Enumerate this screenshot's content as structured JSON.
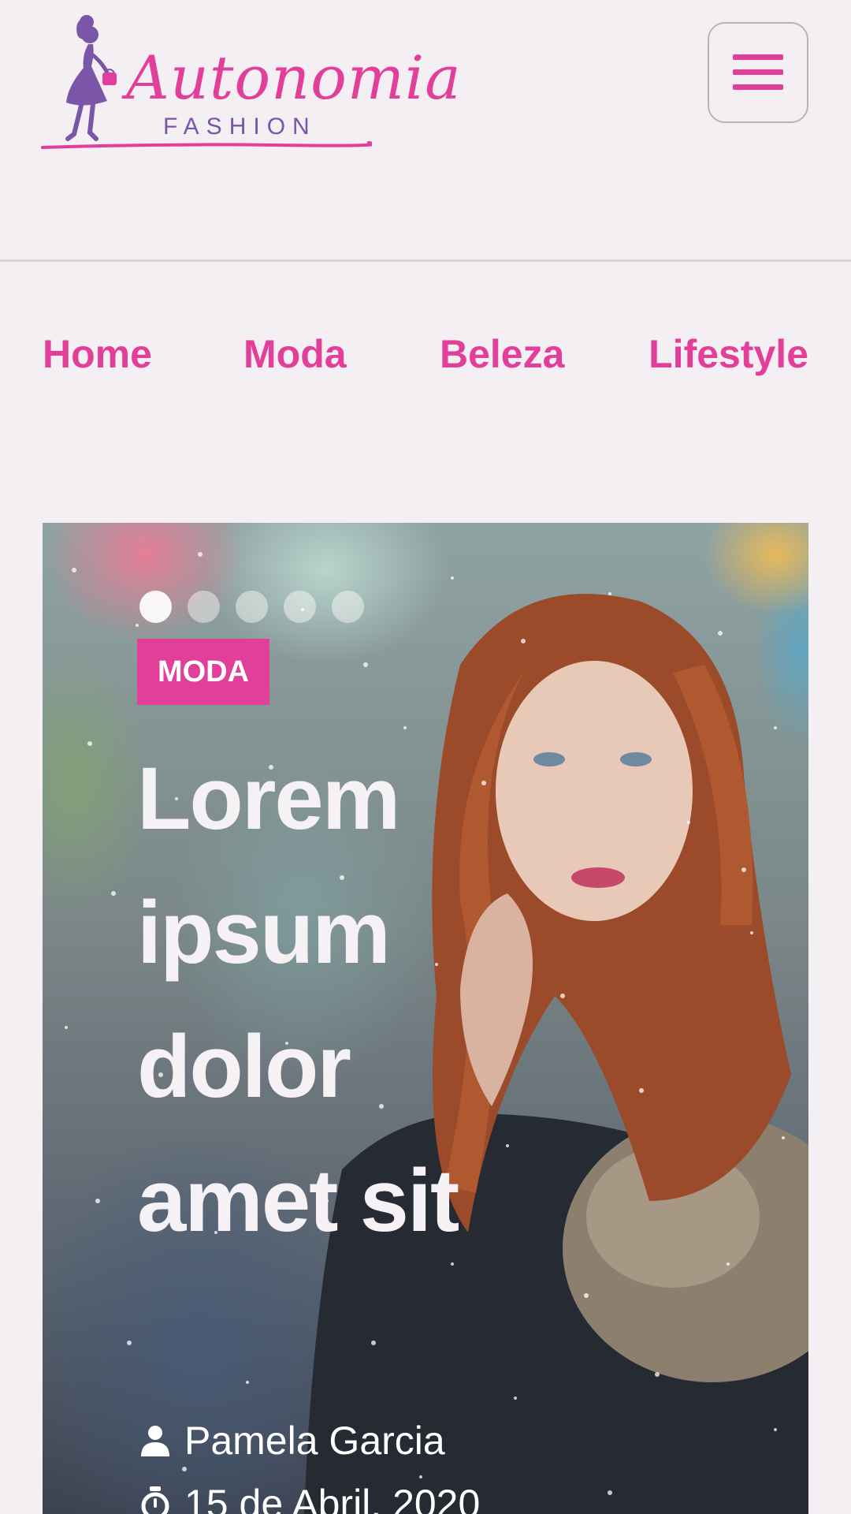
{
  "header": {
    "logo": {
      "name": "Autonomia",
      "tagline": "FASHION"
    },
    "menu_button_icon": "hamburger-menu-icon"
  },
  "nav": {
    "items": [
      {
        "label": "Home"
      },
      {
        "label": "Moda"
      },
      {
        "label": "Beleza"
      },
      {
        "label": "Lifestyle"
      }
    ]
  },
  "hero": {
    "slides_total": 5,
    "active_slide": 1,
    "category": "MODA",
    "title": "Lorem ipsum dolor amet sit",
    "author": "Pamela Garcia",
    "author_icon": "user-icon",
    "date": "15 de Abril, 2020",
    "date_icon": "clock-icon"
  },
  "colors": {
    "brand_pink": "#e23f9a",
    "brand_purple": "#7b55a8",
    "background": "#f3eff2"
  }
}
